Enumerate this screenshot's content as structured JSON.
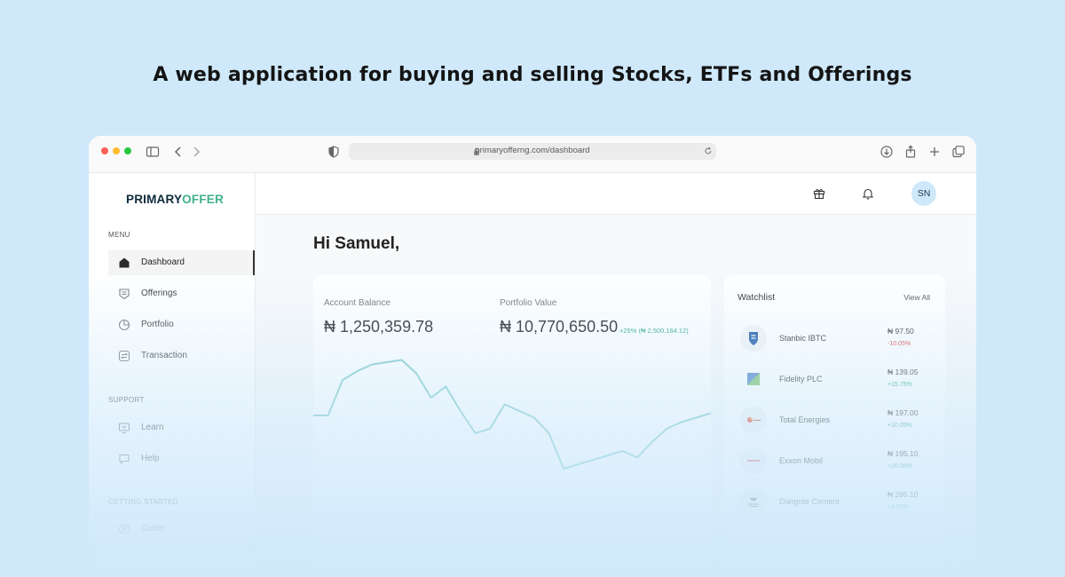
{
  "headline": "A web application for buying and selling Stocks, ETFs and Offerings",
  "browser": {
    "url": "primaryofferng.com/dashboard",
    "traffic_lights": [
      "#fe5f57",
      "#febc2e",
      "#28c840"
    ]
  },
  "brand": {
    "part1": "PRIMARY",
    "part2": "OFFER",
    "color_dark": "#0e2a3a",
    "color_accent": "#3fb08d"
  },
  "sidebar": {
    "menu_label": "MENU",
    "menu": [
      {
        "label": "Dashboard",
        "icon": "home-icon"
      },
      {
        "label": "Offerings",
        "icon": "offerings-icon"
      },
      {
        "label": "Portfolio",
        "icon": "pie-chart-icon"
      },
      {
        "label": "Transaction",
        "icon": "transaction-icon"
      }
    ],
    "support_label": "SUPPORT",
    "support": [
      {
        "label": "Learn",
        "icon": "monitor-icon"
      },
      {
        "label": "Help",
        "icon": "chat-icon"
      }
    ],
    "getting_started_label": "GETTING STARTED",
    "getting_started": [
      {
        "label": "Guide",
        "icon": "compass-icon"
      }
    ]
  },
  "topbar": {
    "avatar_initials": "SN",
    "icons": [
      "gift-icon",
      "bell-icon"
    ]
  },
  "greeting": "Hi Samuel,",
  "balances": {
    "account_label": "Account Balance",
    "account_value": "₦ 1,250,359.78",
    "portfolio_label": "Portfolio Value",
    "portfolio_value": "₦ 10,770,650.50",
    "portfolio_change": "+25% (₦ 2,500,164.12)"
  },
  "chart_data": {
    "type": "line",
    "title": "",
    "xlabel": "",
    "ylabel": "",
    "grid": false,
    "color": "#7ccac7",
    "values": [
      36,
      36,
      52,
      56,
      59,
      60,
      61,
      55,
      44,
      49,
      38,
      28,
      30,
      41,
      38,
      35,
      28,
      12,
      14,
      16,
      18,
      20,
      17,
      24,
      30,
      33,
      35,
      37
    ]
  },
  "watchlist": {
    "title": "Watchlist",
    "view_all": "View All",
    "positive_color": "#2aa58a",
    "negative_color": "#e0443e",
    "items": [
      {
        "name": "Stanbic IBTC",
        "price": "₦ 97.50",
        "change": "-10.05%",
        "direction": "down"
      },
      {
        "name": "Fidelity PLC",
        "price": "₦ 139.05",
        "change": "+15.75%",
        "direction": "up"
      },
      {
        "name": "Total Energies",
        "price": "₦ 197.00",
        "change": "+10.05%",
        "direction": "up"
      },
      {
        "name": "Exxon Mobil",
        "price": "₦ 195.10",
        "change": "+20.05%",
        "direction": "up"
      },
      {
        "name": "Dangote Cement",
        "price": "₦ 295.10",
        "change": "+3.05%",
        "direction": "up"
      }
    ]
  }
}
